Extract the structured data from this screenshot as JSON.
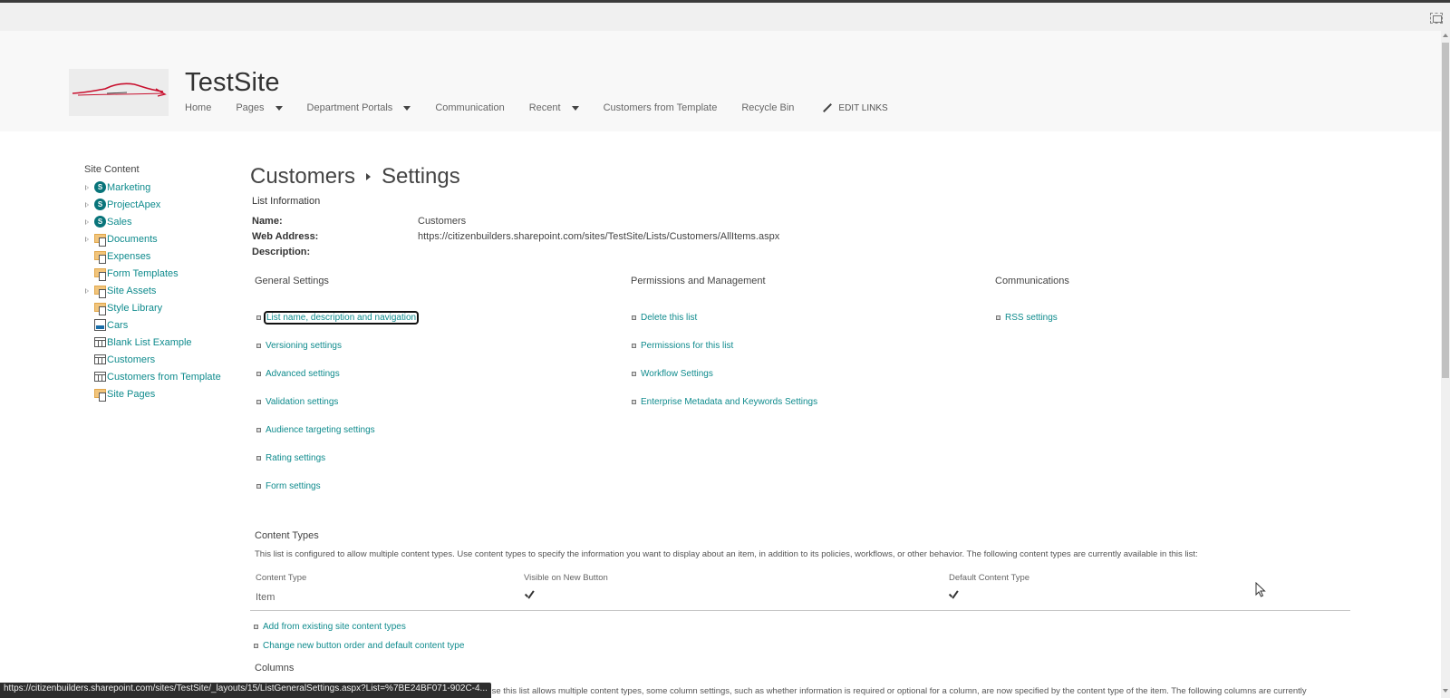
{
  "site": {
    "title": "TestSite",
    "logo": "car-logo"
  },
  "topnav": {
    "items": [
      {
        "label": "Home",
        "dropdown": false
      },
      {
        "label": "Pages",
        "dropdown": true
      },
      {
        "label": "Department Portals",
        "dropdown": true
      },
      {
        "label": "Communication",
        "dropdown": false
      },
      {
        "label": "Recent",
        "dropdown": true
      },
      {
        "label": "Customers from Template",
        "dropdown": false
      },
      {
        "label": "Recycle Bin",
        "dropdown": false
      }
    ],
    "edit_links": "EDIT LINKS"
  },
  "leftnav": {
    "heading": "Site Content",
    "items": [
      {
        "label": "Marketing",
        "icon": "sharepoint-site-icon",
        "expandable": true
      },
      {
        "label": "ProjectApex",
        "icon": "sharepoint-site-icon",
        "expandable": true
      },
      {
        "label": "Sales",
        "icon": "sharepoint-site-icon",
        "expandable": true
      },
      {
        "label": "Documents",
        "icon": "document-library-icon",
        "expandable": true
      },
      {
        "label": "Expenses",
        "icon": "document-library-icon",
        "expandable": false
      },
      {
        "label": "Form Templates",
        "icon": "document-library-icon",
        "expandable": false
      },
      {
        "label": "Site Assets",
        "icon": "document-library-icon",
        "expandable": true
      },
      {
        "label": "Style Library",
        "icon": "document-library-icon",
        "expandable": false
      },
      {
        "label": "Cars",
        "icon": "picture-library-icon",
        "expandable": false
      },
      {
        "label": "Blank List Example",
        "icon": "list-icon",
        "expandable": false
      },
      {
        "label": "Customers",
        "icon": "list-icon",
        "expandable": false
      },
      {
        "label": "Customers from Template",
        "icon": "list-icon",
        "expandable": false
      },
      {
        "label": "Site Pages",
        "icon": "document-library-icon",
        "expandable": false
      }
    ]
  },
  "breadcrumb": {
    "list": "Customers",
    "page": "Settings"
  },
  "list_information": {
    "heading": "List Information",
    "name_label": "Name:",
    "name_value": "Customers",
    "web_address_label": "Web Address:",
    "web_address_value": "https://citizenbuilders.sharepoint.com/sites/TestSite/Lists/Customers/AllItems.aspx",
    "description_label": "Description:",
    "description_value": ""
  },
  "sections": {
    "general": {
      "heading": "General Settings",
      "links": [
        "List name, description and navigation",
        "Versioning settings",
        "Advanced settings",
        "Validation settings",
        "Audience targeting settings",
        "Rating settings",
        "Form settings"
      ]
    },
    "permissions": {
      "heading": "Permissions and Management",
      "links": [
        "Delete this list",
        "Permissions for this list",
        "Workflow Settings",
        "Enterprise Metadata and Keywords Settings"
      ]
    },
    "communications": {
      "heading": "Communications",
      "links": [
        "RSS settings"
      ]
    }
  },
  "content_types": {
    "heading": "Content Types",
    "description": "This list is configured to allow multiple content types. Use content types to specify the information you want to display about an item, in addition to its policies, workflows, or other behavior. The following content types are currently available in this list:",
    "columns": [
      "Content Type",
      "Visible on New Button",
      "Default Content Type"
    ],
    "rows": [
      {
        "name": "Item",
        "visible_on_new": true,
        "default": true
      }
    ],
    "links": [
      "Add from existing site content types",
      "Change new button order and default content type"
    ]
  },
  "columns_section": {
    "heading": "Columns",
    "description_visible": "ecause this list allows multiple content types, some column settings, such as whether information is required or optional for a column, are now specified by the content type of the item. The following columns are currently"
  },
  "status_bar": {
    "url": "https://citizenbuilders.sharepoint.com/sites/TestSite/_layouts/15/ListGeneralSettings.aspx?List=%7BE24BF071-902C-4..."
  },
  "colors": {
    "link": "#0f8b8d",
    "suite_bar_bg": "#f8f8f8",
    "sharepoint_teal": "#08747a"
  }
}
